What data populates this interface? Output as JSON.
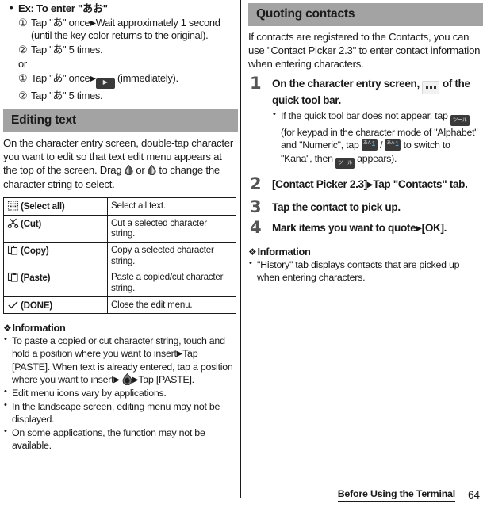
{
  "page": {
    "number": "64",
    "footer_title": "Before Using the Terminal"
  },
  "left_column": {
    "example": {
      "heading": "Ex: To enter \"あお\"",
      "steps": [
        {
          "marker": "①",
          "text_before": "Tap \"あ\" once",
          "arrow": "▶",
          "text_after": "Wait approximately 1 second (until the key color returns to the original)."
        },
        {
          "marker": "②",
          "text_before": "Tap \"あ\" 5 times.",
          "arrow": "",
          "text_after": ""
        }
      ],
      "or_label": "or",
      "steps_alt": [
        {
          "marker": "①",
          "text_before": "Tap \"あ\" once",
          "arrow": "▶",
          "icon": "arrow-key-chip",
          "text_after": "(immediately)."
        },
        {
          "marker": "②",
          "text_before": "Tap \"あ\" 5 times.",
          "arrow": "",
          "text_after": ""
        }
      ]
    },
    "section": {
      "title": "Editing text",
      "body_part1": "On the character entry screen, double-tap character you want to edit so that text edit menu appears at the top of the screen. Drag",
      "handle_left_icon": "selection-handle-left-icon",
      "body_or": "or",
      "handle_right_icon": "selection-handle-right-icon",
      "body_part2": "to change the character string to select."
    },
    "menu_table": {
      "rows": [
        {
          "icon": "select-all-icon",
          "label": "(Select all)",
          "description": "Select all text."
        },
        {
          "icon": "cut-scissors-icon",
          "label": "(Cut)",
          "description": "Cut a selected character string."
        },
        {
          "icon": "copy-icon",
          "label": "(Copy)",
          "description": "Copy a selected character string."
        },
        {
          "icon": "paste-icon",
          "label": "(Paste)",
          "description": "Paste a copied/cut character string."
        },
        {
          "icon": "check-done-icon",
          "label": "(DONE)",
          "description": "Close the edit menu."
        }
      ]
    },
    "information": {
      "heading": "Information",
      "items": [
        {
          "part1": "To paste a copied or cut character string, touch and hold a position where you want to insert",
          "arrow1": "▶",
          "mid": "Tap [PASTE]. When text is already entered, tap a position where you want to insert",
          "arrow2": "▶",
          "icon": "selection-handle-icon",
          "arrow3": "▶",
          "part2": "Tap [PASTE]."
        },
        {
          "part1": "Edit menu icons vary by applications."
        },
        {
          "part1": "In the landscape screen, editing menu may not be displayed."
        },
        {
          "part1": "On some applications, the function may not be available."
        }
      ]
    }
  },
  "right_column": {
    "section": {
      "title": "Quoting contacts",
      "intro": "If contacts are registered to the Contacts, you can use \"Contact Picker 2.3\" to enter contact information when entering characters."
    },
    "steps": [
      {
        "number": "1",
        "title_part1": "On the character entry screen,",
        "title_icon": "quick-tool-bar-dots-icon",
        "title_part2": "of the quick tool bar.",
        "bullets": [
          {
            "t1": "If the quick tool bar does not appear, tap",
            "icon1": "tool-key-icon",
            "t2": "(for keypad in the character mode of \"Alphabet\" and \"Numeric\", tap",
            "icon2": "kana-alphabet-key-icon",
            "sep": "/",
            "icon3": "kana-numeric-key-icon",
            "t3": "to switch to \"Kana\", then",
            "icon4": "tool-key-icon",
            "t4": "appears)."
          }
        ]
      },
      {
        "number": "2",
        "title_part1": "[Contact Picker 2.3]",
        "arrow": "▶",
        "title_part2": "Tap \"Contacts\" tab.",
        "bullets": []
      },
      {
        "number": "3",
        "title_part1": "Tap the contact to pick up.",
        "arrow": "",
        "title_part2": "",
        "bullets": []
      },
      {
        "number": "4",
        "title_part1": "Mark items you want to quote",
        "arrow": "▶",
        "title_part2": "[OK].",
        "bullets": []
      }
    ],
    "information": {
      "heading": "Information",
      "items": [
        {
          "part1": "\"History\" tab displays contacts that are picked up when entering characters."
        }
      ]
    }
  },
  "colors": {
    "section_bar_bg": "#a3a3a3",
    "text": "#1a1a1a",
    "step_number": "#555555",
    "chip_dark": "#3a3a3a",
    "chip_accent_blue": "#5fa8dd"
  }
}
